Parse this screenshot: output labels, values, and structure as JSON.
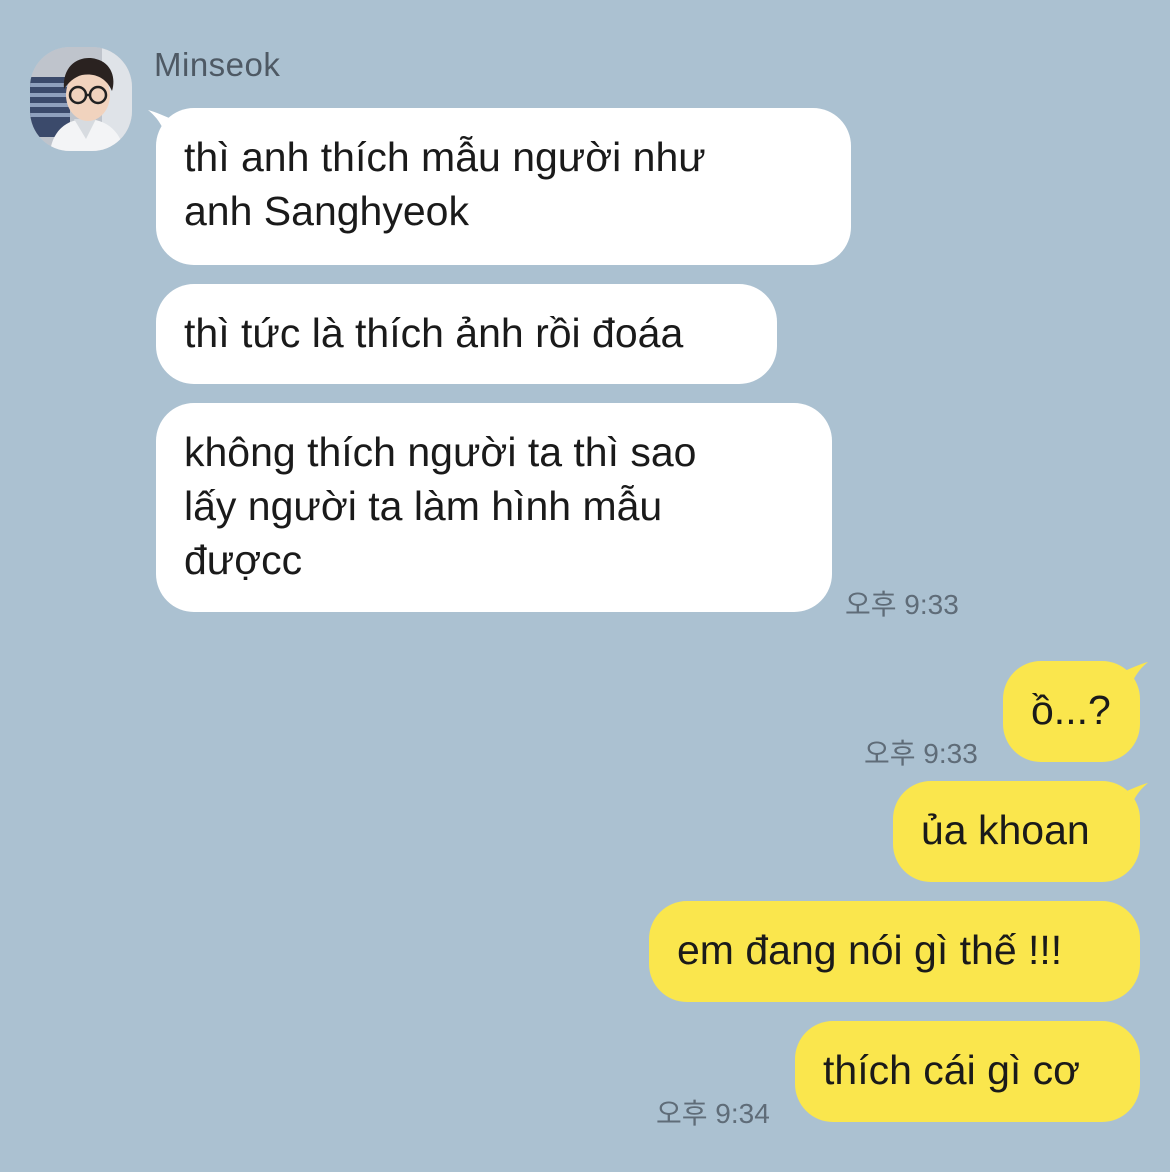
{
  "contact": {
    "name": "Minseok"
  },
  "incoming": [
    {
      "text": "thì anh thích mẫu người như\nanh Sanghyeok"
    },
    {
      "text": "thì tức là thích ảnh rồi đoáa"
    },
    {
      "text": "không thích người ta thì sao\nlấy người ta làm hình mẫu\nđượcc",
      "time": "오후 9:33"
    }
  ],
  "outgoing": [
    {
      "text": "ồ...?",
      "time": "오후 9:33"
    },
    {
      "text": "ủa khoan"
    },
    {
      "text": "em đang nói gì thế !!!"
    },
    {
      "text": "thích cái gì cơ",
      "time": "오후 9:34"
    }
  ],
  "colors": {
    "background": "#abc1d1",
    "incoming_bubble": "#ffffff",
    "outgoing_bubble": "#fae64d"
  }
}
